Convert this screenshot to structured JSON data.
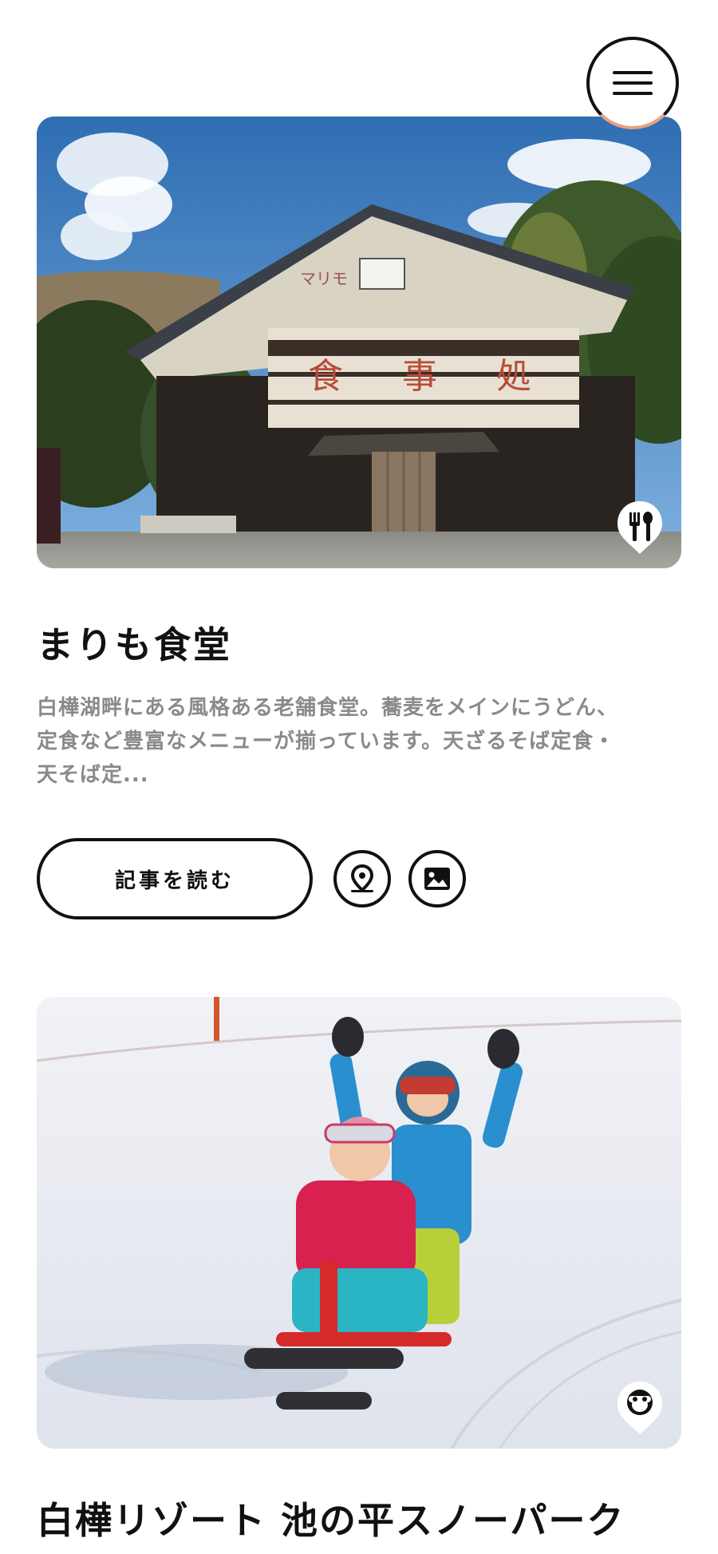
{
  "header": {
    "menu_icon": "hamburger-icon"
  },
  "cards": [
    {
      "title": "まりも食堂",
      "image_description_icon": "restaurant-pin-icon",
      "description_lines": [
        "白樺湖畔にある風格ある老舗食堂。蕎麦をメインにうどん、",
        "定食など豊富なメニューが揃っています。天ざるそば定食・",
        "天そば定..."
      ],
      "read_button_label": "記事を読む",
      "map_icon": "map-pin-icon",
      "gallery_icon": "image-icon",
      "sign_text": "マリモ",
      "banner_text": "食 事 処"
    },
    {
      "title": "白樺リゾート 池の平スノーパーク",
      "image_description_icon": "activity-pin-icon"
    }
  ],
  "colors": {
    "text": "#111111",
    "muted_text": "#8a8a8a",
    "menu_accent": "#e9a07f",
    "background": "#ffffff"
  }
}
